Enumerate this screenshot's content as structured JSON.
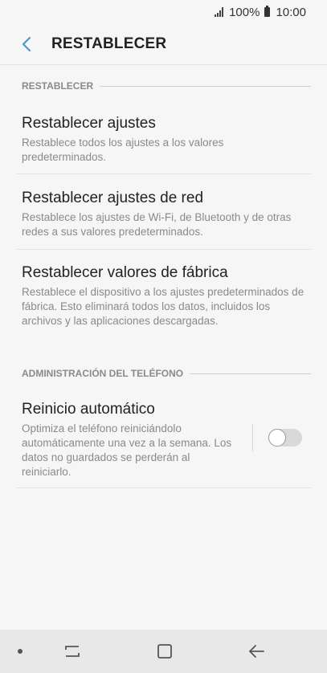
{
  "status_bar": {
    "battery": "100%",
    "time": "10:00",
    "icons": [
      "signal-icon",
      "battery-icon"
    ]
  },
  "app_bar": {
    "back_icon": "chevron-left-icon",
    "title": "RESTABLECER"
  },
  "sections": [
    {
      "header": "RESTABLECER",
      "items": [
        {
          "title": "Restablecer ajustes",
          "description": "Restablece todos los ajustes a los valores predeterminados."
        },
        {
          "title": "Restablecer ajustes de red",
          "description": "Restablece los ajustes de Wi-Fi, de Bluetooth y de otras redes a sus valores predeterminados."
        },
        {
          "title": "Restablecer valores de fábrica",
          "description": "Restablece el dispositivo a los ajustes predeterminados de fábrica. Esto eliminará todos los datos, incluidos los archivos y las aplicaciones descargadas."
        }
      ]
    },
    {
      "header": "ADMINISTRACIÓN DEL TELÉFONO",
      "items": [
        {
          "title": "Reinicio automático",
          "description": "Optimiza el teléfono reiniciándolo automáticamente una vez a la semana. Los datos no guardados se perderán al reiniciarlo.",
          "toggle_on": false
        }
      ]
    }
  ],
  "nav_bar": {
    "icons": [
      "nav-dot-icon",
      "recent-apps-icon",
      "home-icon",
      "back-arrow-icon"
    ]
  },
  "colors": {
    "accent": "#4a9cc7",
    "background": "#f6f6f6",
    "nav_background": "#e8e8e8"
  }
}
